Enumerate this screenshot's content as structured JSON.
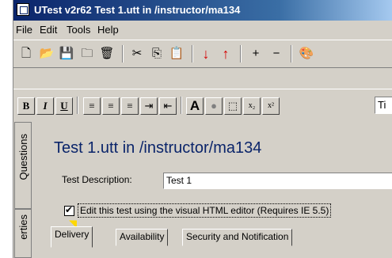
{
  "window": {
    "title": "UTest v2r62 Test 1.utt in /instructor/ma134"
  },
  "menu": {
    "items": [
      {
        "label": "File",
        "mnemonic": "F"
      },
      {
        "label": "Edit",
        "mnemonic": "E"
      },
      {
        "label": "Tools",
        "mnemonic": "T"
      },
      {
        "label": "Help",
        "mnemonic": "H"
      }
    ]
  },
  "toolbar": {
    "buttons": [
      {
        "name": "new-document-icon",
        "glyph": "🗋"
      },
      {
        "name": "open-folder-icon",
        "glyph": "📂"
      },
      {
        "name": "save-disk-icon",
        "glyph": "💾"
      },
      {
        "name": "folder-icon",
        "glyph": "🗀"
      },
      {
        "name": "trash-icon",
        "glyph": "🗑"
      },
      {
        "name": "cut-icon",
        "glyph": "✂"
      },
      {
        "name": "copy-icon",
        "glyph": "⎘"
      },
      {
        "name": "paste-icon",
        "glyph": "📋"
      },
      {
        "name": "move-down-icon",
        "glyph": "↓"
      },
      {
        "name": "move-up-icon",
        "glyph": "↑"
      },
      {
        "name": "add-icon",
        "glyph": "+"
      },
      {
        "name": "remove-icon",
        "glyph": "−"
      },
      {
        "name": "palette-icon",
        "glyph": "🎨"
      }
    ]
  },
  "formatbar": {
    "bold": "B",
    "italic": "I",
    "underline": "U",
    "font_size_label": "A",
    "subscript": "x₂",
    "superscript": "x²",
    "font_name_value": "Ti"
  },
  "sidebar": {
    "tabs": [
      "Questions",
      "erties"
    ]
  },
  "main": {
    "title": "Test 1.utt in /instructor/ma134",
    "description_label": "Test Description:",
    "description_value": "Test 1",
    "visual_editor_checked": true,
    "visual_editor_label": "Edit this test using the visual HTML editor (Requires IE 5.5)",
    "tabs": [
      {
        "label": "Delivery",
        "active": true
      },
      {
        "label": "Availability",
        "active": false
      },
      {
        "label": "Security and Notification",
        "active": false
      }
    ]
  },
  "colors": {
    "title_blue": "#0a246a",
    "window_gray": "#d4d0c8",
    "arrow_red": "#d40000"
  }
}
